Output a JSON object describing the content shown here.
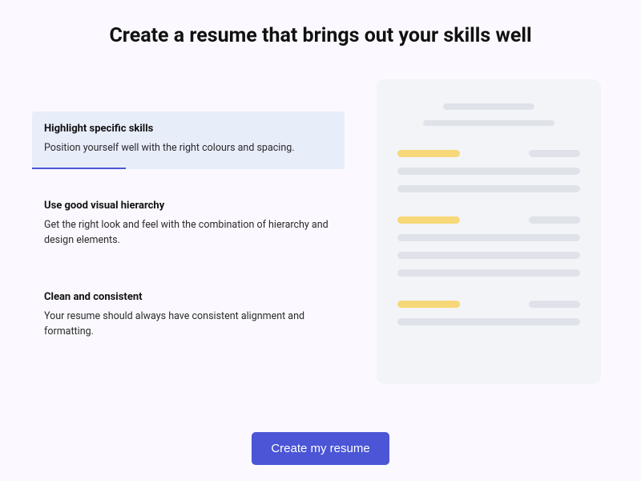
{
  "heading": "Create a resume that brings out your skills well",
  "options": [
    {
      "title": "Highlight specific skills",
      "desc": "Position yourself well with the right colours and spacing.",
      "selected": true
    },
    {
      "title": "Use good visual hierarchy",
      "desc": "Get the right look and feel with the combination of hierarchy and design elements.",
      "selected": false
    },
    {
      "title": "Clean and consistent",
      "desc": "Your resume should always have consistent alignment and formatting.",
      "selected": false
    }
  ],
  "cta_label": "Create my resume"
}
